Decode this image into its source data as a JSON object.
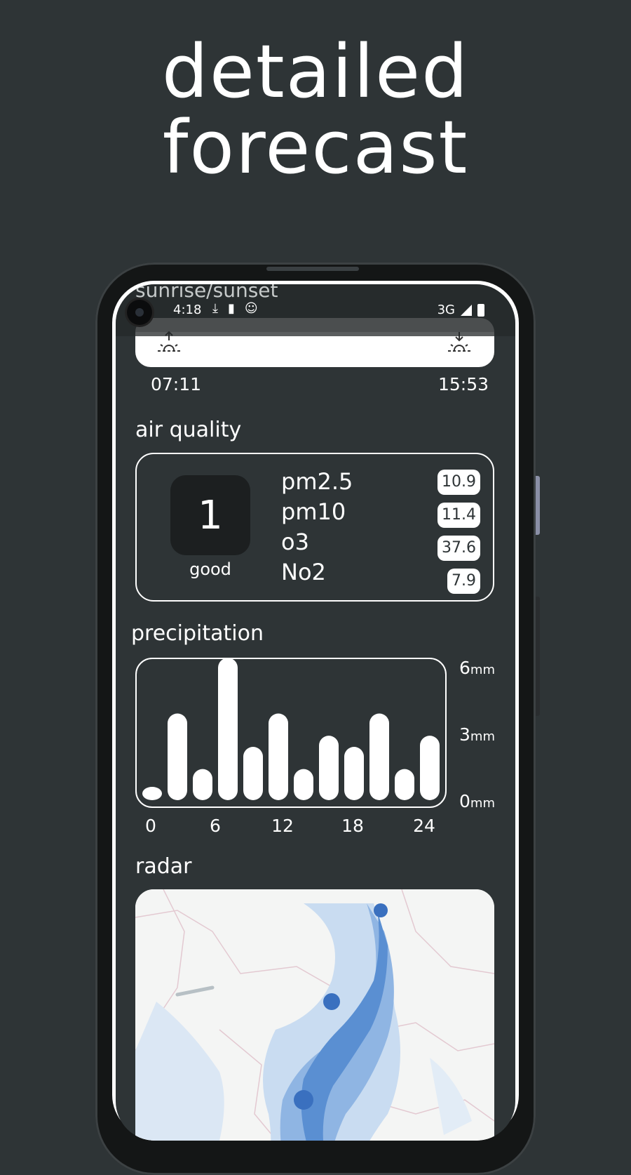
{
  "headline": {
    "line1": "detailed",
    "line2": "forecast"
  },
  "status_bar": {
    "time": "4:18",
    "network": "3G"
  },
  "sunrise_sunset": {
    "title": "sunrise/sunset",
    "sunrise": "07:11",
    "sunset": "15:53"
  },
  "air_quality": {
    "title": "air quality",
    "index": "1",
    "label": "good",
    "pollutants": [
      {
        "name": "pm2.5",
        "value": "10.9"
      },
      {
        "name": "pm10",
        "value": "11.4"
      },
      {
        "name": "o3",
        "value": "37.6"
      },
      {
        "name": "No2",
        "value": "7.9"
      }
    ]
  },
  "precipitation": {
    "title": "precipitation"
  },
  "chart_data": {
    "type": "bar",
    "x": [
      0,
      2,
      4,
      6,
      8,
      10,
      12,
      14,
      16,
      18,
      20,
      22,
      24
    ],
    "values": [
      0.6,
      3.9,
      1.4,
      6.4,
      2.4,
      3.9,
      1.4,
      2.9,
      2.4,
      3.9,
      1.4,
      2.9
    ],
    "xticks": [
      "0",
      "6",
      "12",
      "18",
      "24"
    ],
    "yticks": [
      {
        "num": "6",
        "unit": "mm"
      },
      {
        "num": "3",
        "unit": "mm"
      },
      {
        "num": "0",
        "unit": "mm"
      }
    ],
    "ylim": [
      0,
      6
    ],
    "grid": false
  },
  "radar": {
    "title": "radar"
  },
  "colors": {
    "background": "#2e3436",
    "foreground": "#ffffff",
    "radar_rain": "#3a78c6"
  }
}
